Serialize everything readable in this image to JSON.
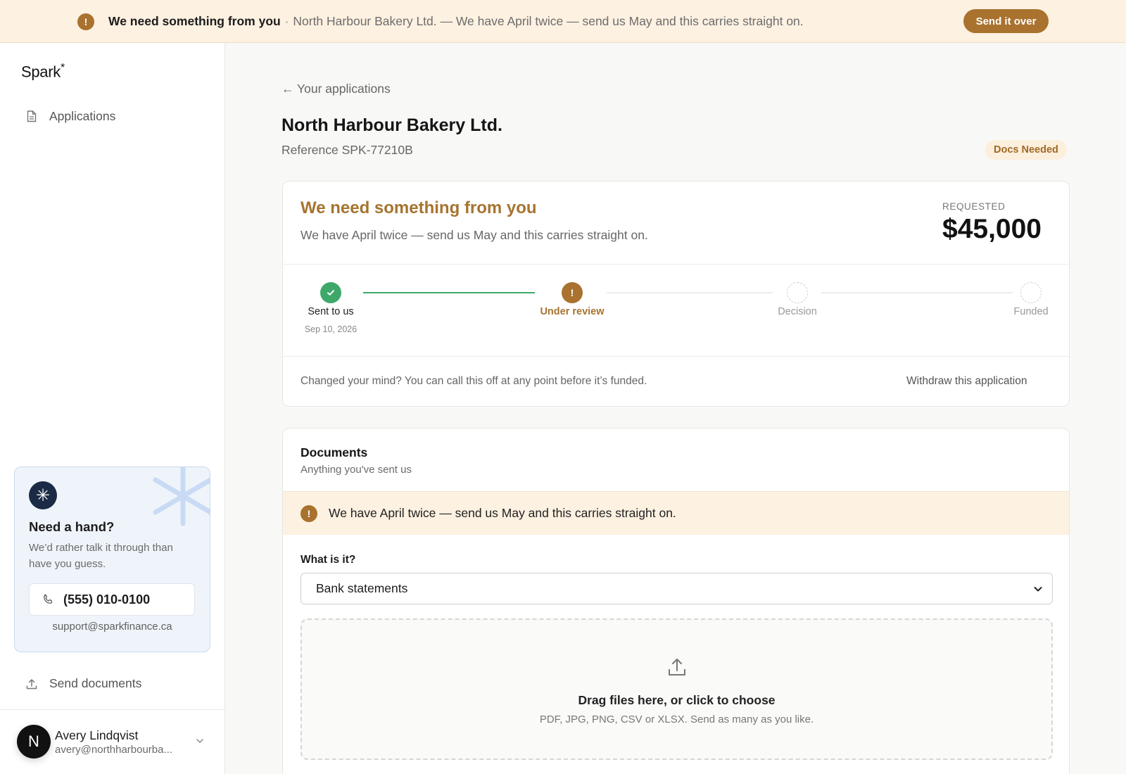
{
  "banner": {
    "title": "We need something from you",
    "separator": "·",
    "message": "North Harbour Bakery Ltd. — We have April twice — send us May and this carries straight on.",
    "button_label": "Send it over",
    "icon": "alert-icon",
    "accent": "#a9722e"
  },
  "sidebar": {
    "logo": "Spark",
    "logo_mark": "*",
    "items": [
      {
        "label": "Applications",
        "icon": "document-icon"
      },
      {
        "label": "Send documents",
        "icon": "upload-icon"
      }
    ],
    "help": {
      "title": "Need a hand?",
      "body": "We’d rather talk it through than have you guess.",
      "phone": "(555) 010-0100",
      "email": "support@sparkfinance.ca",
      "mark": "✳"
    },
    "user": {
      "initial": "N",
      "name": "Avery Lindqvist",
      "email": "avery@northharbourba..."
    }
  },
  "main": {
    "back_label": "← Your applications",
    "title": "North Harbour Bakery Ltd.",
    "reference": "Reference SPK-77210B",
    "status_badge": "Docs Needed",
    "status_card": {
      "title": "We need something from you",
      "message": "We have April twice — send us May and this carries straight on.",
      "requested_label": "REQUESTED",
      "requested_amount": "$45,000",
      "steps": [
        {
          "label": "Sent to us",
          "date": "Sep 10, 2026",
          "state": "done"
        },
        {
          "label": "Under review",
          "date": "",
          "state": "attention"
        },
        {
          "label": "Decision",
          "date": "",
          "state": "pending"
        },
        {
          "label": "Funded",
          "date": "",
          "state": "pending"
        }
      ],
      "withdraw_note": "Changed your mind? You can call this off at any point before it’s funded.",
      "withdraw_label": "Withdraw this application"
    },
    "documents": {
      "title": "Documents",
      "subtitle": "Anything you've sent us",
      "alert": "We have April twice — send us May and this carries straight on.",
      "field_label": "What is it?",
      "selected_type": "Bank statements",
      "dropzone_title": "Drag files here, or click to choose",
      "dropzone_sub": "PDF, JPG, PNG, CSV or XLSX. Send as many as you like."
    }
  },
  "colors": {
    "accent": "#a9722e",
    "success": "#3ea86a",
    "badge_bg": "#fcefdc",
    "banner_bg": "#fdf1e1"
  }
}
